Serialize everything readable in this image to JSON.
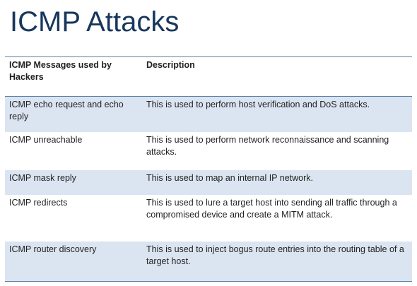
{
  "slide": {
    "title": "ICMP Attacks"
  },
  "table": {
    "headers": {
      "message": "ICMP Messages used by Hackers",
      "description": "Description"
    },
    "rows": [
      {
        "message": "ICMP echo request and echo reply",
        "description": "This is used to perform host verification and DoS attacks."
      },
      {
        "message": "ICMP unreachable",
        "description": "This is used to perform network reconnaissance and scanning attacks."
      },
      {
        "message": "ICMP mask reply",
        "description": "This is used to map an internal IP network."
      },
      {
        "message": "ICMP redirects",
        "description": "This is used to lure a target host into sending all traffic through a compromised device and create a MITM attack."
      },
      {
        "message": "ICMP router discovery",
        "description": "This is used to inject bogus route entries into the routing table of a target host."
      }
    ]
  },
  "colors": {
    "title": "#17375e",
    "rule": "#5a7fa8",
    "row_shade": "#dbe5f1"
  }
}
